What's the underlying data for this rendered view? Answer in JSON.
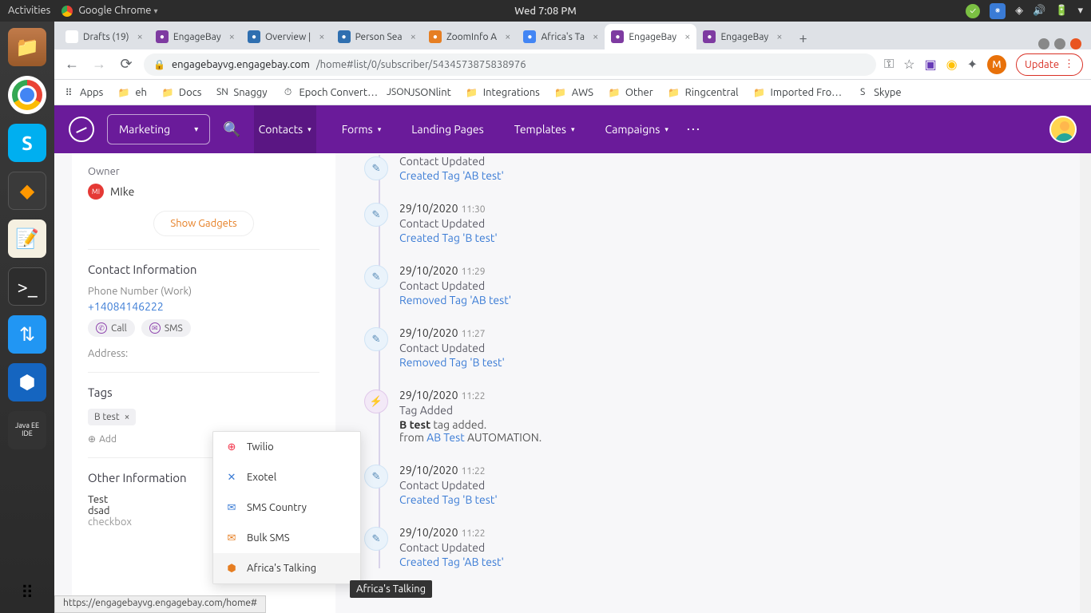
{
  "ubuntu": {
    "activities": "Activities",
    "app": "Google Chrome",
    "clock": "Wed  7:08 PM"
  },
  "tabs": [
    {
      "label": "Drafts (19)",
      "favColor": "#fff"
    },
    {
      "label": "EngageBay",
      "favColor": "#7e3ba1"
    },
    {
      "label": "Overview |",
      "favColor": "#2f6fb0"
    },
    {
      "label": "Person Sea",
      "favColor": "#2f6fb0"
    },
    {
      "label": "ZoomInfo A",
      "favColor": "#e67e22"
    },
    {
      "label": "Africa's Ta",
      "favColor": "#4285f4"
    },
    {
      "label": "EngageBay",
      "favColor": "#7e3ba1",
      "active": true
    },
    {
      "label": "EngageBay",
      "favColor": "#7e3ba1"
    }
  ],
  "addr": {
    "domain": "engagebayvg.engagebay.com",
    "path": "/home#list/0/subscriber/5434573875838976"
  },
  "update": "Update",
  "bookmarks": [
    {
      "label": "Apps",
      "icon": "⠿"
    },
    {
      "label": "eh",
      "icon": "📁"
    },
    {
      "label": "Docs",
      "icon": "📁"
    },
    {
      "label": "Snaggy",
      "icon": "SN"
    },
    {
      "label": "Epoch Convert…",
      "icon": "⏱"
    },
    {
      "label": "JSONlint",
      "icon": "JSON"
    },
    {
      "label": "Integrations",
      "icon": "📁"
    },
    {
      "label": "AWS",
      "icon": "📁"
    },
    {
      "label": "Other",
      "icon": "📁"
    },
    {
      "label": "Ringcentral",
      "icon": "📁"
    },
    {
      "label": "Imported Fro…",
      "icon": "📁"
    },
    {
      "label": "Skype",
      "icon": "S"
    }
  ],
  "header": {
    "marketing": "Marketing",
    "nav": [
      "Contacts",
      "Forms",
      "Landing Pages",
      "Templates",
      "Campaigns"
    ]
  },
  "sidebar": {
    "owner_label": "Owner",
    "owner_name": "MIke",
    "show_gadgets": "Show Gadgets",
    "contact_info": "Contact Information",
    "phone_label": "Phone Number (Work)",
    "phone": "+14084146222",
    "call": "Call",
    "sms": "SMS",
    "address": "Address:",
    "tags": "Tags",
    "tag1": "B test",
    "add": "Add",
    "other_info": "Other Information",
    "test_label": "Test",
    "test_val": "dsad",
    "checkbox": "checkbox"
  },
  "sms_menu": [
    "Twilio",
    "Exotel",
    "SMS Country",
    "Bulk SMS",
    "Africa's Talking"
  ],
  "tooltip": "Africa's Talking",
  "timeline": [
    {
      "date": "",
      "time": "",
      "title": "Contact Updated",
      "desc": "Created Tag 'AB test'",
      "icon": "edit"
    },
    {
      "date": "29/10/2020",
      "time": "11:30",
      "title": "Contact Updated",
      "desc": "Created Tag 'B test'",
      "icon": "edit"
    },
    {
      "date": "29/10/2020",
      "time": "11:29",
      "title": "Contact Updated",
      "desc": "Removed Tag 'AB test'",
      "icon": "edit"
    },
    {
      "date": "29/10/2020",
      "time": "11:27",
      "title": "Contact Updated",
      "desc": "Removed Tag 'B test'",
      "icon": "edit"
    },
    {
      "date": "29/10/2020",
      "time": "11:22",
      "title": "Tag Added",
      "desc_html": "<span class='bold'>B test</span> <span class='plain'>tag added.</span><br><span class='plain'>from </span>AB Test <span class='plain'>AUTOMATION.</span>",
      "icon": "bolt"
    },
    {
      "date": "29/10/2020",
      "time": "11:22",
      "title": "Contact Updated",
      "desc": "Created Tag 'B test'",
      "icon": "edit"
    },
    {
      "date": "29/10/2020",
      "time": "11:22",
      "title": "Contact Updated",
      "desc": "Created Tag 'AB test'",
      "icon": "edit"
    }
  ],
  "status_url": "https://engagebayvg.engagebay.com/home#"
}
